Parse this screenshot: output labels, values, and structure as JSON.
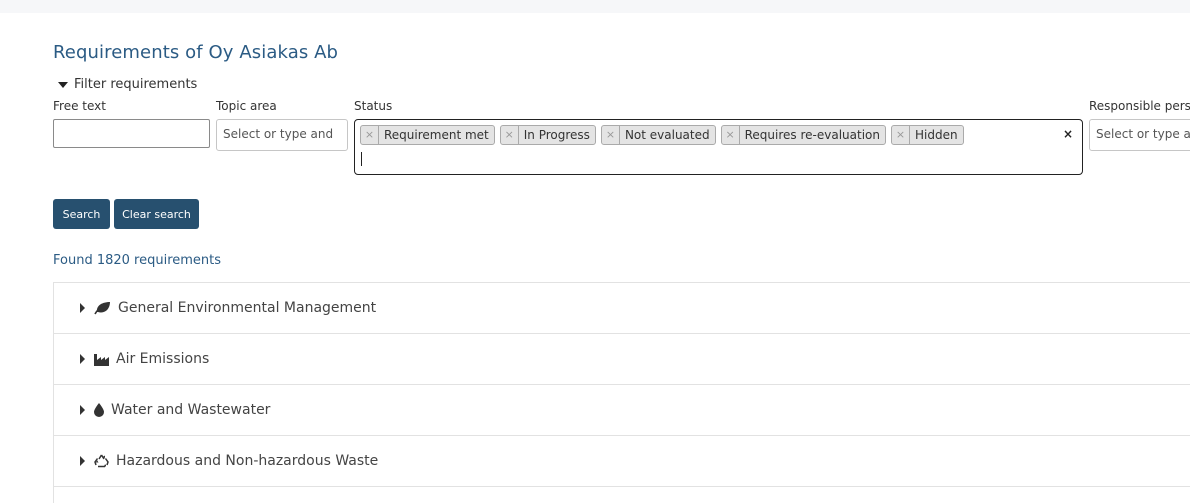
{
  "page": {
    "title": "Requirements of Oy Asiakas Ab"
  },
  "filter": {
    "toggle_label": "Filter requirements",
    "free_text": {
      "label": "Free text",
      "value": "",
      "placeholder": ""
    },
    "topic_area": {
      "label": "Topic area",
      "placeholder": "Select or type and"
    },
    "status": {
      "label": "Status",
      "tags": [
        "Requirement met",
        "In Progress",
        "Not evaluated",
        "Requires re-evaluation",
        "Hidden"
      ],
      "clear_symbol": "×",
      "remove_symbol": "×"
    },
    "responsible": {
      "label": "Responsible pers",
      "placeholder": "Select or type and"
    }
  },
  "buttons": {
    "search": "Search",
    "clear": "Clear search"
  },
  "results": {
    "found_text": "Found 1820 requirements"
  },
  "categories": [
    {
      "label": "General Environmental Management",
      "icon": "leaf-icon"
    },
    {
      "label": "Air Emissions",
      "icon": "factory-icon"
    },
    {
      "label": "Water and Wastewater",
      "icon": "water-drop-icon"
    },
    {
      "label": "Hazardous and Non-hazardous Waste",
      "icon": "recycle-icon"
    }
  ],
  "colors": {
    "accent": "#2b5b84",
    "button": "#27506f",
    "tag_bg": "#e4e4e4"
  }
}
